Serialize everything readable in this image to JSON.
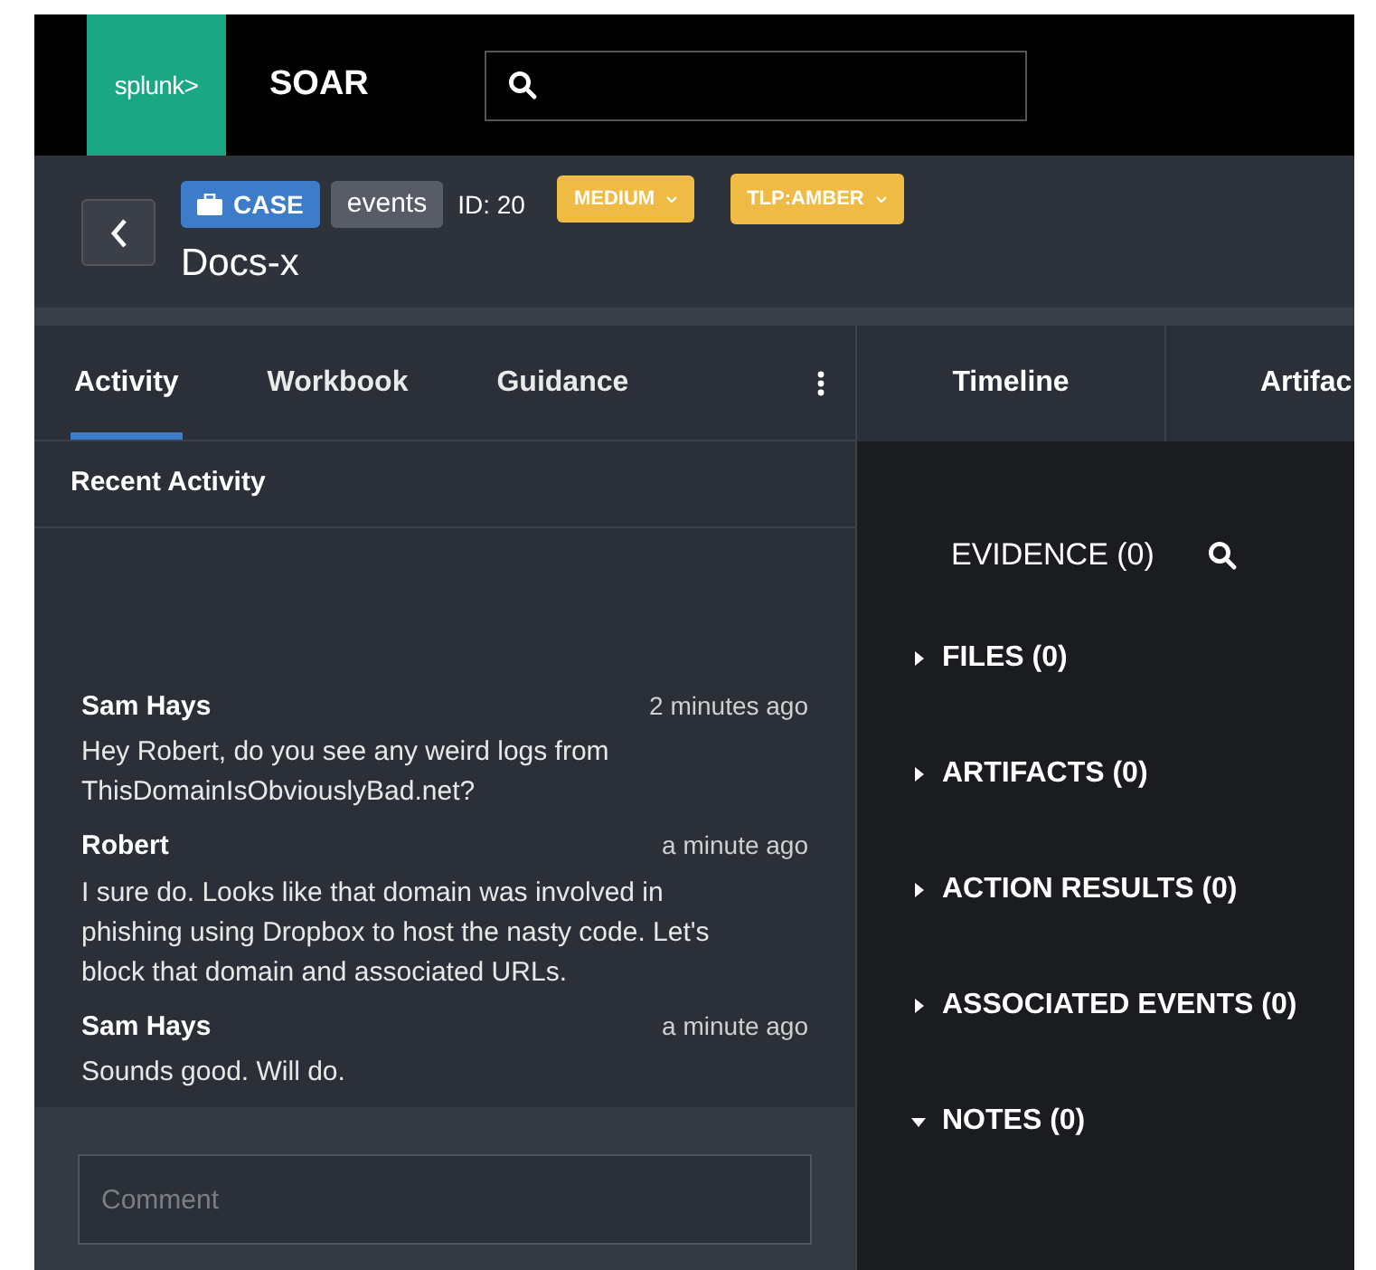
{
  "topbar": {
    "logo": "splunk>",
    "product": "SOAR"
  },
  "case": {
    "type_badge": "CASE",
    "label_badge": "events",
    "id": "ID: 20",
    "severity": "MEDIUM",
    "tlp": "TLP:AMBER",
    "title": "Docs-x"
  },
  "left_tabs": [
    {
      "label": "Activity",
      "selected": true
    },
    {
      "label": "Workbook",
      "selected": false
    },
    {
      "label": "Guidance",
      "selected": false
    }
  ],
  "right_tabs": [
    {
      "label": "Timeline",
      "selected": false
    },
    {
      "label": "Artifac",
      "selected": false
    }
  ],
  "activity": {
    "heading": "Recent Activity",
    "comments": [
      {
        "author": "Sam Hays",
        "time": "2 minutes ago",
        "text": "Hey Robert, do you see any weird logs from ThisDomainIsObviouslyBad.net?"
      },
      {
        "author": "Robert",
        "time": "a minute ago",
        "text": "I sure do. Looks like that domain was involved in phishing using Dropbox to host the nasty code. Let's block that domain and associated URLs."
      },
      {
        "author": "Sam Hays",
        "time": "a minute ago",
        "text": "Sounds good. Will do."
      }
    ],
    "comment_field": {
      "placeholder": "Comment"
    }
  },
  "evidence": {
    "heading": "EVIDENCE (0)",
    "sections": [
      {
        "label": "FILES (0)",
        "expanded": false
      },
      {
        "label": "ARTIFACTS (0)",
        "expanded": false
      },
      {
        "label": "ACTION RESULTS (0)",
        "expanded": false
      },
      {
        "label": "ASSOCIATED EVENTS (0)",
        "expanded": false
      },
      {
        "label": "NOTES (0)",
        "expanded": true
      }
    ]
  }
}
